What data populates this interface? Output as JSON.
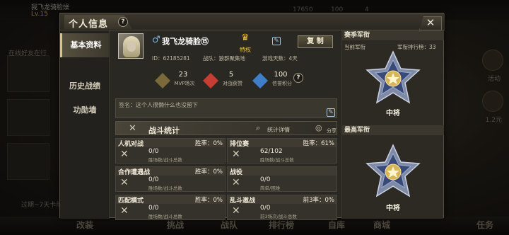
{
  "background": {
    "top_bar": {
      "player_name": "我飞龙骑脸燥",
      "level": "Lv.15",
      "currency_1": "17650",
      "currency_2": "100",
      "currency_3": "4"
    },
    "left_text": "在线好友在行",
    "left_text_2": "过期~7天卡前间",
    "bottom_menu": [
      "改装",
      "挑战",
      "战队",
      "排行榜",
      "自库",
      "商城",
      "任务"
    ],
    "right_labels": [
      "活动",
      "1.2元"
    ]
  },
  "dialog": {
    "title": "个人信息",
    "help": "?",
    "close": "✕"
  },
  "nav": {
    "items": [
      {
        "label": "基本资料"
      },
      {
        "label": "历史战绩"
      },
      {
        "label": "功勋墙"
      }
    ]
  },
  "profile": {
    "gender_icon": "♂",
    "name": "我飞龙骑脸⑮",
    "privilege_label": "特权",
    "copy_label": "复 制",
    "id_line": "ID：62185281",
    "team_line": "战队：狼群聚集地",
    "days_line": "游戏天数：4天",
    "stats": [
      {
        "value": "23",
        "label": "MVP场次",
        "icon": "mvp-icon",
        "color": "#7a6a3a"
      },
      {
        "value": "5",
        "label": "对战获赞",
        "icon": "heart-icon",
        "color": "#c63d34"
      },
      {
        "value": "100",
        "label": "信誉积分",
        "icon": "star-icon",
        "color": "#3f7fc8"
      }
    ],
    "signature": "签名：这个人很懒什么也没留下"
  },
  "battle_stats": {
    "title": "战斗统计",
    "detail_label": "统计详情",
    "share_label": "分享",
    "modes": [
      {
        "name": "人机对战",
        "winrate": "胜率：0%",
        "value": "0/0",
        "sub": "胜场数/战斗总数"
      },
      {
        "name": "排位赛",
        "winrate": "胜率：61%",
        "value": "62/102",
        "sub": "胜场数/战斗总数"
      },
      {
        "name": "合作遭遇战",
        "winrate": "胜率：0%",
        "value": "0/0",
        "sub": "胜场数/战斗总数"
      },
      {
        "name": "战役",
        "winrate": "",
        "value": "0/0",
        "sub": "简单/困难"
      },
      {
        "name": "匹配模式",
        "winrate": "胜率：0%",
        "value": "0/0",
        "sub": "胜场数/战斗总数"
      },
      {
        "name": "乱斗邀战",
        "winrate": "前3率：0%",
        "value": "0/0",
        "sub": "前3场次/战斗总数"
      }
    ]
  },
  "rank": {
    "section_title": "赛季军衔",
    "current_label": "当前军衔",
    "ranking_label": "军衔排行榜：33",
    "current_name": "中将",
    "best_label": "最高军衔",
    "best_name": "中将"
  }
}
